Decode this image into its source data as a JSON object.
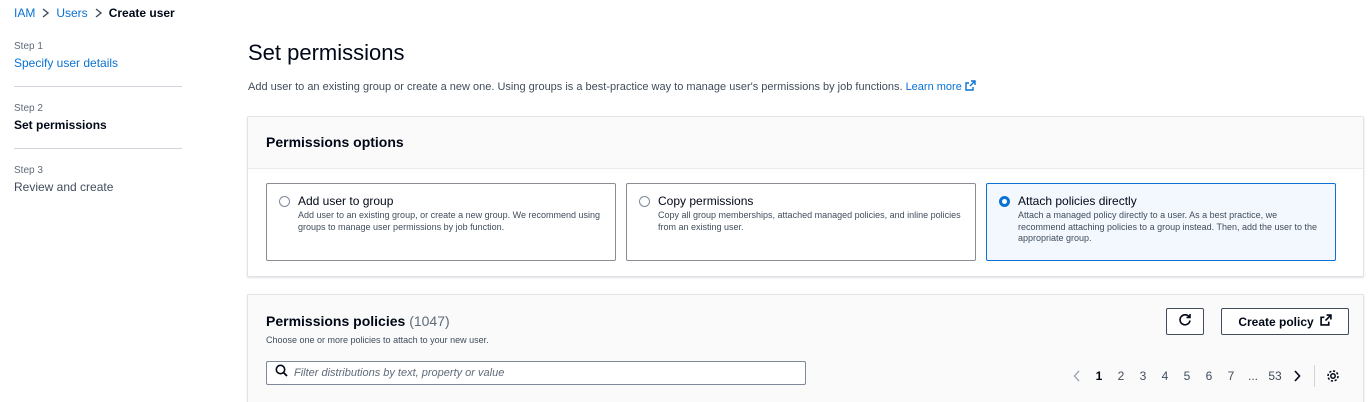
{
  "breadcrumb": {
    "items": [
      "IAM",
      "Users"
    ],
    "current": "Create user"
  },
  "steps": [
    {
      "num": "Step 1",
      "label": "Specify user details"
    },
    {
      "num": "Step 2",
      "label": "Set permissions"
    },
    {
      "num": "Step 3",
      "label": "Review and create"
    }
  ],
  "page": {
    "title": "Set permissions",
    "description": "Add user to an existing group or create a new one. Using groups is a best-practice way to manage user's permissions by job functions.",
    "learn_more": "Learn more"
  },
  "permissions_options": {
    "header": "Permissions options",
    "selected": "Attach policies directly",
    "tiles": [
      {
        "title": "Add user to group",
        "desc": "Add user to an existing group, or create a new group. We recommend using groups to manage user permissions by job function."
      },
      {
        "title": "Copy permissions",
        "desc": "Copy all group memberships, attached managed policies, and inline policies from an existing user."
      },
      {
        "title": "Attach policies directly",
        "desc": "Attach a managed policy directly to a user. As a best practice, we recommend attaching policies to a group instead. Then, add the user to the appropriate group."
      }
    ]
  },
  "policies": {
    "title": "Permissions policies",
    "count": "(1047)",
    "desc": "Choose one or more policies to attach to your new user.",
    "search_placeholder": "Filter distributions by text, property or value",
    "create_label": "Create policy",
    "pages": [
      "1",
      "2",
      "3",
      "4",
      "5",
      "6",
      "7",
      "...",
      "53"
    ],
    "current_page": "1"
  },
  "colors": {
    "accent": "#0972d3",
    "selected_bg": "#f2f8fd"
  },
  "icons": [
    "chevron-right-icon",
    "external-link-icon",
    "refresh-icon",
    "search-icon",
    "chevron-left-icon",
    "settings-gear-icon"
  ]
}
